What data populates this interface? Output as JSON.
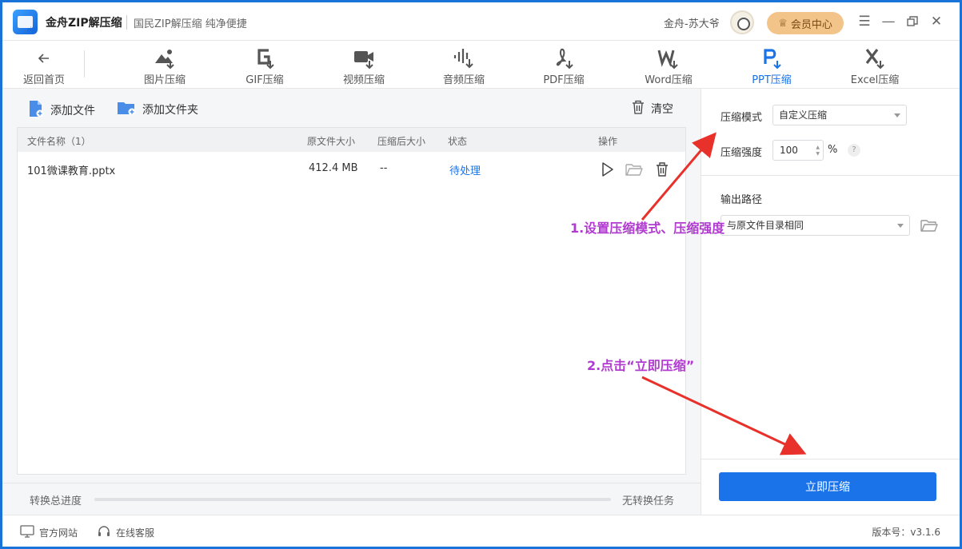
{
  "app": {
    "name": "金舟ZIP解压缩",
    "slogan": "国民ZIP解压缩  纯净便捷",
    "username": "金舟-苏大爷",
    "vip_label": "会员中心"
  },
  "toolbar": {
    "back_label": "返回首页",
    "tools": [
      {
        "label": "图片压缩",
        "icon": "image-compress-icon"
      },
      {
        "label": "GIF压缩",
        "icon": "gif-compress-icon"
      },
      {
        "label": "视频压缩",
        "icon": "video-compress-icon"
      },
      {
        "label": "音频压缩",
        "icon": "audio-compress-icon"
      },
      {
        "label": "PDF压缩",
        "icon": "pdf-compress-icon"
      },
      {
        "label": "Word压缩",
        "icon": "word-compress-icon"
      },
      {
        "label": "PPT压缩",
        "icon": "ppt-compress-icon",
        "active": true
      },
      {
        "label": "Excel压缩",
        "icon": "excel-compress-icon"
      }
    ]
  },
  "actions": {
    "add_file": "添加文件",
    "add_folder": "添加文件夹",
    "clear": "清空"
  },
  "table": {
    "headers": {
      "name": "文件名称（1）",
      "original_size": "原文件大小",
      "compressed_size": "压缩后大小",
      "status": "状态",
      "operation": "操作"
    },
    "rows": [
      {
        "name": "101微课教育.pptx",
        "original_size": "412.4 MB",
        "compressed_size": "--",
        "status": "待处理"
      }
    ]
  },
  "progress": {
    "label": "转换总进度",
    "value_fraction": 0,
    "status_text": "无转换任务"
  },
  "settings": {
    "mode_label": "压缩模式",
    "mode_value": "自定义压缩",
    "strength_label": "压缩强度",
    "strength_value": "100",
    "strength_unit": "%",
    "help": "?",
    "output_label": "输出路径",
    "output_value": "与原文件目录相同",
    "compress_button": "立即压缩"
  },
  "statusbar": {
    "website": "官方网站",
    "support": "在线客服",
    "version": "版本号：v3.1.6"
  },
  "annotations": {
    "step1": "1.设置压缩模式、压缩强度",
    "step2": "2.点击“立即压缩”",
    "color": "#b13bd0",
    "arrow_color": "#e8312b"
  },
  "colors": {
    "accent": "#1a73e8",
    "vip": "#f3c489"
  }
}
